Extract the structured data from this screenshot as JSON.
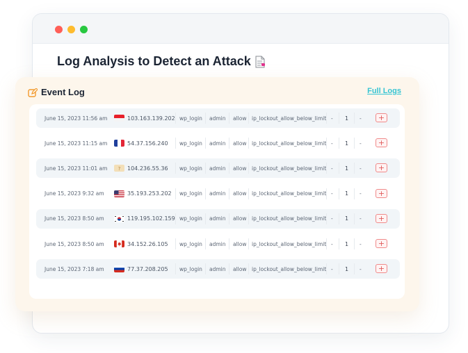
{
  "page": {
    "title": "Log Analysis to Detect an Attack"
  },
  "card": {
    "title": "Event Log",
    "full_logs_link": "Full Logs"
  },
  "colors": {
    "accent": "#36c5d3",
    "card_bg": "#fdf6ec",
    "add_button": "#f08a8a"
  },
  "logs": [
    {
      "date": "June 15, 2023 11:56 am",
      "flag": "indonesia-flag-icon",
      "ip": "103.163.139.202",
      "action": "wp_login",
      "user": "admin",
      "status": "allow",
      "reason": "ip_lockout_allow_below_limit",
      "dash1": "-",
      "count": "1",
      "dash2": "-",
      "add": "+"
    },
    {
      "date": "June 15, 2023 11:15 am",
      "flag": "france-flag-icon",
      "ip": "54.37.156.240",
      "action": "wp_login",
      "user": "admin",
      "status": "allow",
      "reason": "ip_lockout_allow_below_limit",
      "dash1": "-",
      "count": "1",
      "dash2": "-",
      "add": "+"
    },
    {
      "date": "June 15, 2023 11:01 am",
      "flag": "unknown-flag-icon",
      "ip": "104.236.55.36",
      "action": "wp_login",
      "user": "admin",
      "status": "allow",
      "reason": "ip_lockout_allow_below_limit",
      "dash1": "-",
      "count": "1",
      "dash2": "-",
      "add": "+"
    },
    {
      "date": "June 15, 2023 9:32 am",
      "flag": "usa-flag-icon",
      "ip": "35.193.253.202",
      "action": "wp_login",
      "user": "admin",
      "status": "allow",
      "reason": "ip_lockout_allow_below_limit",
      "dash1": "-",
      "count": "1",
      "dash2": "-",
      "add": "+"
    },
    {
      "date": "June 15, 2023 8:50 am",
      "flag": "south-korea-flag-icon",
      "ip": "119.195.102.159",
      "action": "wp_login",
      "user": "admin",
      "status": "allow",
      "reason": "ip_lockout_allow_below_limit",
      "dash1": "-",
      "count": "1",
      "dash2": "-",
      "add": "+"
    },
    {
      "date": "June 15, 2023 8:50 am",
      "flag": "canada-flag-icon",
      "ip": "34.152.26.105",
      "action": "wp_login",
      "user": "admin",
      "status": "allow",
      "reason": "ip_lockout_allow_below_limit",
      "dash1": "-",
      "count": "1",
      "dash2": "-",
      "add": "+"
    },
    {
      "date": "June 15, 2023 7:18 am",
      "flag": "russia-flag-icon",
      "ip": "77.37.208.205",
      "action": "wp_login",
      "user": "admin",
      "status": "allow",
      "reason": "ip_lockout_allow_below_limit",
      "dash1": "-",
      "count": "1",
      "dash2": "-",
      "add": "+"
    }
  ]
}
